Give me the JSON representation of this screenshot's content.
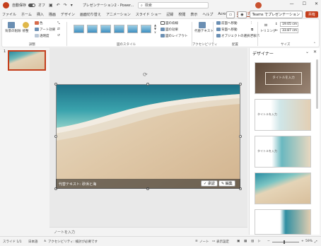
{
  "titlebar": {
    "autosave_label": "自動保存",
    "autosave_state": "オフ",
    "document_title": "プレゼンテーション2 - Power...",
    "search_placeholder": "検索",
    "win_min": "—",
    "win_max": "☐",
    "win_close": "✕"
  },
  "tabs": {
    "items": [
      "ファイル",
      "ホーム",
      "挿入",
      "描画",
      "デザイン",
      "画面切り替え",
      "アニメーション",
      "スライド ショー",
      "記録",
      "校閲",
      "表示",
      "ヘルプ",
      "Acrobat",
      "図の形式"
    ],
    "active_index": 13,
    "teams_label": "Teams でプレゼンテーション",
    "share_label": "共有"
  },
  "ribbon": {
    "remove_bg_label": "背景の削除",
    "adjust_label": "修整",
    "color_label": "色",
    "art_effects_label": "アート効果",
    "transparency_label": "透明度",
    "adjust_group": "調整",
    "styles_group": "図のスタイル",
    "border_label": "図の枠線",
    "effects_label": "図の効果",
    "layout_label": "図のレイアウト",
    "alt_text_label": "代替テキスト",
    "accessibility_group": "アクセシビリティ",
    "bring_forward_label": "前面へ移動",
    "send_backward_label": "背面へ移動",
    "selection_pane_label": "オブジェクトの選択と表示",
    "arrange_group": "配置",
    "crop_label": "トリミング",
    "height_value": "19.05 cm",
    "width_value": "33.87 cm",
    "size_group": "サイズ"
  },
  "thumbs": {
    "slide_number": "1"
  },
  "editor": {
    "alt_text": "代替テキスト: 砂浜と海",
    "approve_label": "承認",
    "edit_label": "編集"
  },
  "notes": {
    "placeholder": "ノートを入力"
  },
  "designer": {
    "title": "デザイナー",
    "card_title": "タイトルを入力"
  },
  "statusbar": {
    "slide_info": "スライド 1/1",
    "language": "日本語",
    "accessibility": "アクセシビリティ: 検討が必要です",
    "notes": "ノート",
    "display_settings": "表示設定",
    "zoom": "59%"
  }
}
